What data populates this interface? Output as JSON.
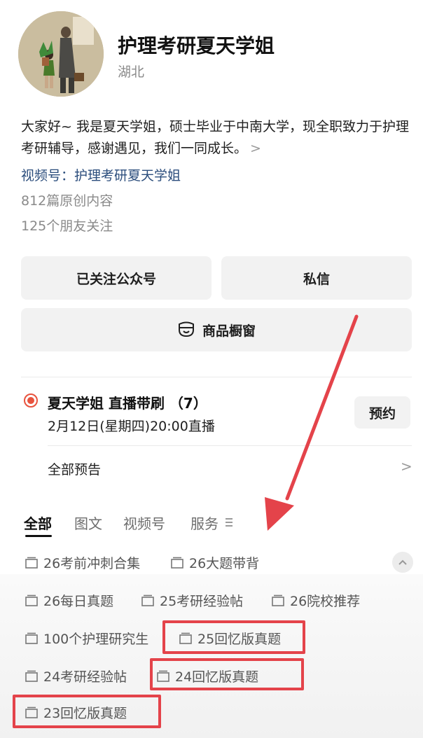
{
  "profile": {
    "name": "护理考研夏天学姐",
    "location": "湖北",
    "bio": "大家好~ 我是夏天学姐，硕士毕业于中南大学，现全职致力于护理考研辅导，感谢遇见，我们一同成长。",
    "bio_chevron": ">",
    "channel": "视频号：护理考研夏天学姐",
    "articles": "812篇原创内容",
    "followers": "125个朋友关注"
  },
  "actions": {
    "followed": "已关注公众号",
    "message": "私信",
    "shop": "商品橱窗"
  },
  "live": {
    "title": "夏天学姐 直播带刷 （7）",
    "time": "2月12日(星期四)20:00直播",
    "reserve": "预约",
    "all_previews": "全部预告",
    "chevron": ">"
  },
  "tabs": [
    "全部",
    "图文",
    "视频号",
    "服务"
  ],
  "tags": [
    "26考前冲刺合集",
    "26大题带背",
    "26每日真题",
    "25考研经验帖",
    "26院校推荐",
    "100个护理研究生",
    "25回忆版真题",
    "24考研经验帖",
    "24回忆版真题",
    "23回忆版真题"
  ],
  "colors": {
    "accent_link": "#2b4d7c",
    "live_dot": "#e8533e",
    "annotation": "#e4434a"
  }
}
